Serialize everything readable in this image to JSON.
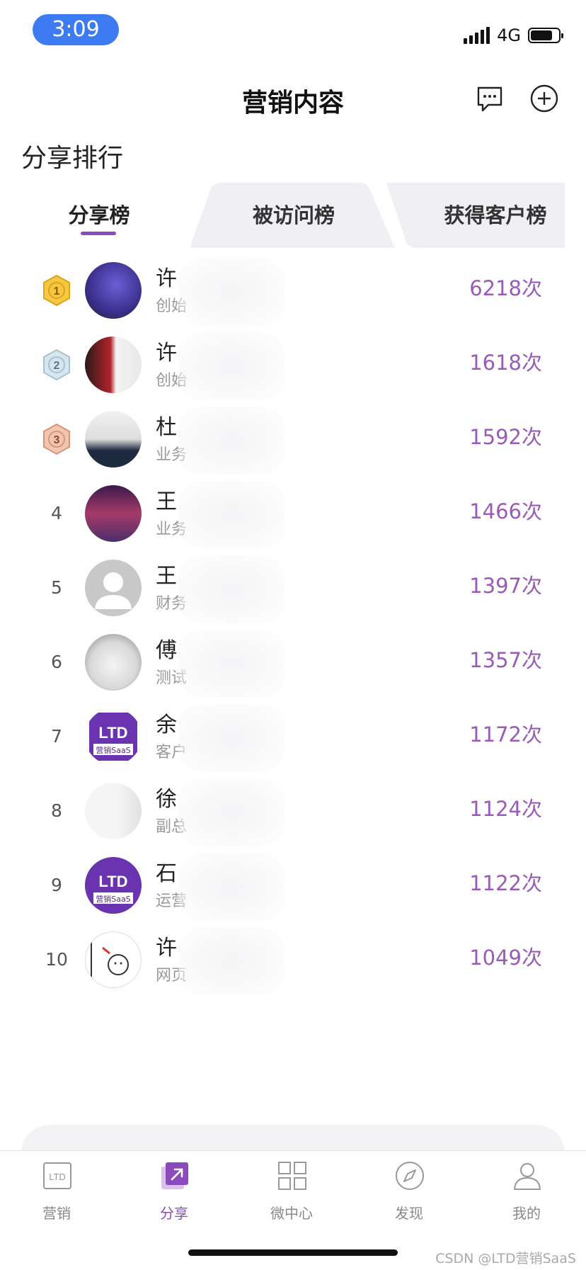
{
  "status": {
    "time": "3:09",
    "network": "4G",
    "battery_level": 0.8
  },
  "header": {
    "title": "营销内容",
    "message_icon": "chat-bubble-icon",
    "add_icon": "plus-circle-icon"
  },
  "section_title": "分享排行",
  "tabs": [
    {
      "label": "分享榜",
      "active": true
    },
    {
      "label": "被访问榜",
      "active": false
    },
    {
      "label": "获得客户榜",
      "active": false
    }
  ],
  "ranking": [
    {
      "rank": "1",
      "medal": "gold",
      "name": "许",
      "sub": "创始",
      "count": "6218次"
    },
    {
      "rank": "2",
      "medal": "silver",
      "name": "许",
      "sub": "创始",
      "count": "1618次"
    },
    {
      "rank": "3",
      "medal": "bronze",
      "name": "杜",
      "sub": "业务",
      "count": "1592次"
    },
    {
      "rank": "4",
      "name": "王",
      "sub": "业务",
      "count": "1466次"
    },
    {
      "rank": "5",
      "name": "王",
      "sub": "财务",
      "count": "1397次"
    },
    {
      "rank": "6",
      "name": "傅",
      "sub": "测试",
      "count": "1357次"
    },
    {
      "rank": "7",
      "name": "余",
      "sub": "客户",
      "count": "1172次"
    },
    {
      "rank": "8",
      "name": "徐",
      "sub": "副总",
      "count": "1124次"
    },
    {
      "rank": "9",
      "name": "石",
      "sub": "运营",
      "count": "1122次"
    },
    {
      "rank": "10",
      "name": "许",
      "sub": "网页",
      "count": "1049次"
    }
  ],
  "tabbar": [
    {
      "label": "营销",
      "icon": "ltd-icon",
      "active": false
    },
    {
      "label": "分享",
      "icon": "share-icon",
      "active": true
    },
    {
      "label": "微中心",
      "icon": "grid-icon",
      "active": false
    },
    {
      "label": "发现",
      "icon": "compass-icon",
      "active": false
    },
    {
      "label": "我的",
      "icon": "person-icon",
      "active": false
    }
  ],
  "logo_text": {
    "ltd": "LTD",
    "saas": "营销SaaS"
  },
  "watermark": "CSDN @LTD营销SaaS",
  "colors": {
    "accent": "#8c4bbd",
    "count": "#9a5bb8",
    "status_pill": "#3d7bf3",
    "tab_bg": "#f0f0f4"
  }
}
